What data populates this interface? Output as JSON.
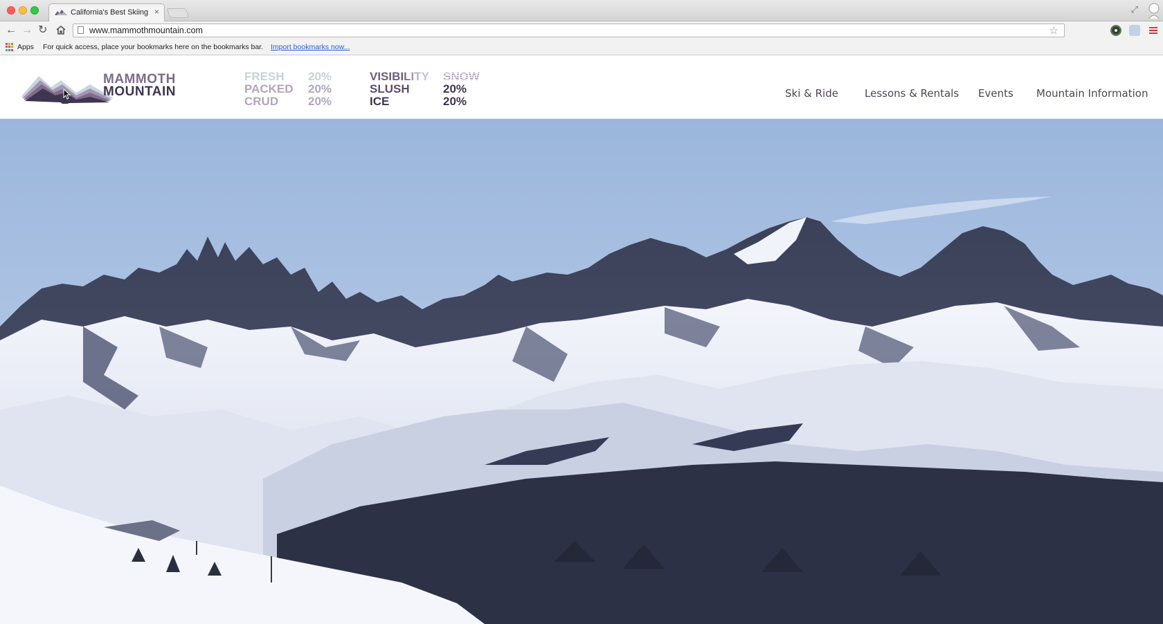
{
  "browser": {
    "tab_title": "California's Best Skiing",
    "tab_close": "×",
    "url": "www.mammothmountain.com",
    "bookmarks_apps": "Apps",
    "bookmarks_hint": "For quick access, place your bookmarks here on the bookmarks bar.",
    "bookmarks_import": "Import bookmarks now..."
  },
  "site": {
    "logo": {
      "line1": "MAMMOTH",
      "line2": "MOUNTAIN"
    },
    "conditions": {
      "col1": [
        "FRESH",
        "PACKED",
        "CRUD"
      ],
      "col2": [
        "20%",
        "20%",
        "20%"
      ],
      "col3": [
        "VISIBILITY",
        "SLUSH",
        "ICE"
      ],
      "col4": [
        "SNOW",
        "20%",
        "20%"
      ]
    },
    "nav": [
      "Ski & Ride",
      "Lessons & Rentals",
      "Events",
      "Mountain Information"
    ]
  },
  "colors": {
    "logo_light": "#7d6b8a",
    "logo_dark": "#3f3550",
    "condition_faded": "#c5d4da",
    "condition_mid": "#b3a6ba",
    "condition_dark": "#5b4d6a",
    "sky_top": "#9bb6dc",
    "sky_horizon": "#c6d6ee",
    "rock": "#434a63",
    "snow": "#eef1f9"
  },
  "icons": [
    "back-icon",
    "forward-icon",
    "reload-icon",
    "home-icon",
    "star-icon",
    "menu-icon",
    "apps-icon"
  ]
}
